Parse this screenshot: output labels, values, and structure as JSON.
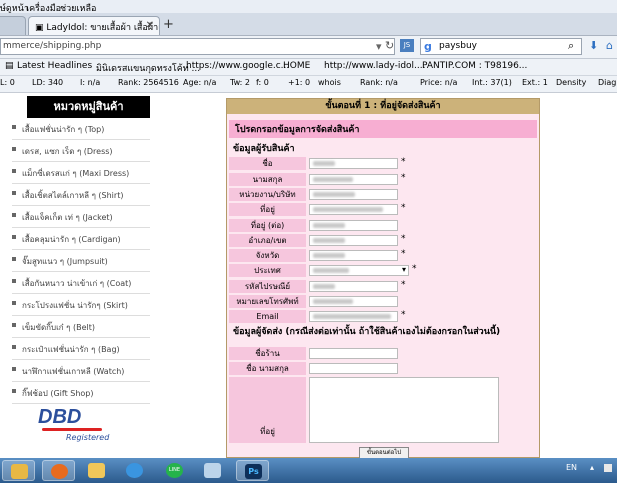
{
  "browser": {
    "menu": [
      "ษ์ดูหน้า",
      "เครื่องมือ",
      "ช่วยเหลือ"
    ],
    "tabs": [
      {
        "label": "LadyIdol: ขายเสื้อผ้า เสื้อผ้าแ..."
      }
    ],
    "url": "mmerce/shipping.php",
    "search_value": "paysbuy",
    "bookmarks": [
      "Latest Headlines",
      "มินิเดรสแขนกุดทรงโค้ท ...",
      "https://www.google.c...",
      "HOME",
      "http://www.lady-idol....",
      "PANTIP.COM : T98196..."
    ],
    "seo": [
      "L: 0",
      "LD: 340",
      "I: n/a",
      "Rank: 2564516",
      "Age: n/a",
      "Tw: 2",
      "f: 0",
      "+1: 0",
      "whois",
      "Rank: n/a",
      "Price: n/a",
      "Int.: 37(1)",
      "Ext.: 1",
      "Density",
      "Diagn"
    ]
  },
  "sidebar": {
    "header": "หมวดหมู่สินค้า",
    "items": [
      "เสื้อแฟชั่นน่ารัก ๆ (Top)",
      "เดรส, แซก เร็ด ๆ (Dress)",
      "แม็กซี่เดรสแก่ ๆ (Maxi Dress)",
      "เสื้อเชิ้ตสไตล์เกาหลี ๆ (Shirt)",
      "เสื้อแจ็คเก็ต เท่ ๆ (Jacket)",
      "เสื้อคลุมน่ารัก ๆ (Cardigan)",
      "จั๊มสูทแนว ๆ (Jumpsuit)",
      "เสื้อกันหนาว น่าเข้าเก่ ๆ (Coat)",
      "กระโปรงแฟชั่น น่ารักๆ (Skirt)",
      "เข็มขัดกิ๊บเก๋ ๆ (Belt)",
      "กระเป๋าแฟชั่นน่ารัก ๆ (Bag)",
      "นาฬิกาแฟชั่นเกาหลี (Watch)",
      "กิ๊ฟช้อป (Gift Shop)"
    ],
    "badge_top": "DBD",
    "badge_bottom": "Registered"
  },
  "form": {
    "step_title": "ขั้นตอนที่ 1 : ที่อยู่จัดส่งสินค้า",
    "section_title": "โปรดกรอกข้อมูลการจัดส่งสินค้า",
    "receiver_title": "ข้อมูลผู้รับสินค้า",
    "receiver_fields": [
      {
        "label": "ชื่อ",
        "required": "*"
      },
      {
        "label": "นามสกุล",
        "required": "*"
      },
      {
        "label": "หน่วยงาน/บริษัท",
        "required": ""
      },
      {
        "label": "ที่อยู่",
        "required": "*"
      },
      {
        "label": "ที่อยู่ (ต่อ)",
        "required": ""
      },
      {
        "label": "อำเภอ/เขต",
        "required": "*"
      },
      {
        "label": "จังหวัด",
        "required": "*"
      },
      {
        "label": "ประเทศ",
        "required": "*"
      },
      {
        "label": "รหัสไปรษณีย์",
        "required": "*"
      },
      {
        "label": "หมายเลขโทรศัพท์",
        "required": ""
      },
      {
        "label": "Email",
        "required": "*"
      }
    ],
    "sender_title": "ข้อมูลผู้จัดส่ง (กรณีส่งต่อเท่านั้น ถ้าใช้สินค้าเองไม่ต้องกรอกในส่วนนี้)",
    "sender_fields": [
      {
        "label": "ชื่อร้าน"
      },
      {
        "label": "ชื่อ นามสกุล"
      },
      {
        "label": "ที่อยู่"
      }
    ],
    "submit_label": "ขั้นตอนต่อไป"
  },
  "taskbar": {
    "lang": "EN",
    "ps_label": "Ps",
    "line_label": "LINE"
  }
}
